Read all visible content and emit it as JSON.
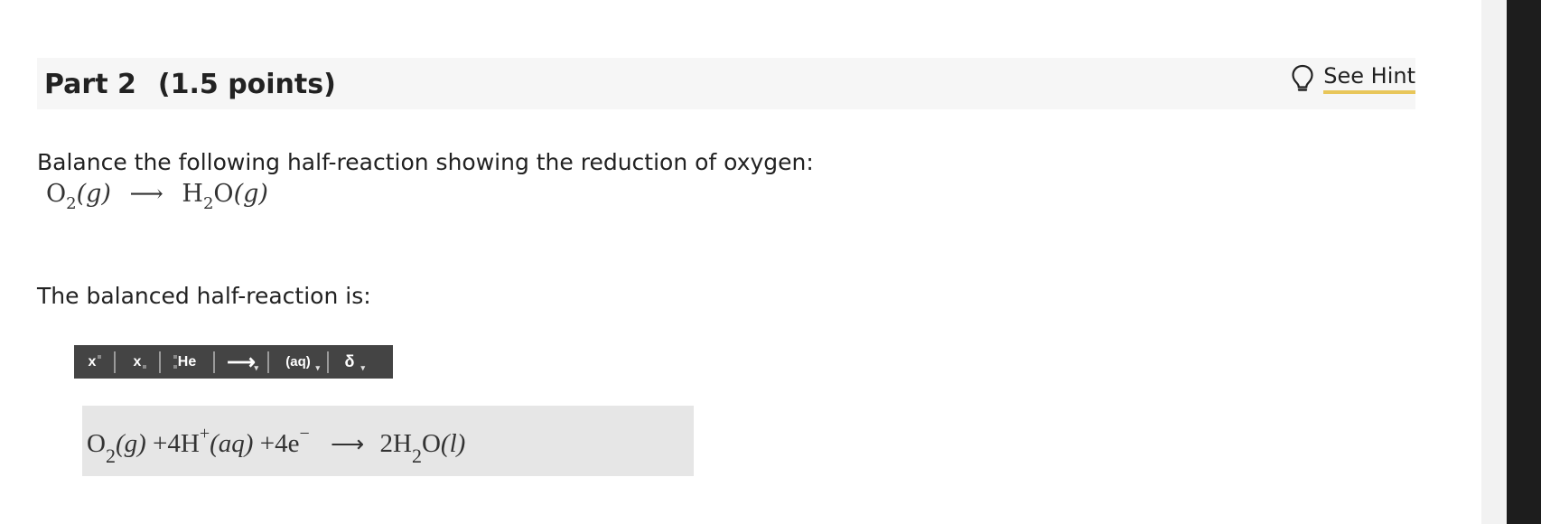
{
  "part": {
    "title": "Part 2",
    "points": "(1.5 points)",
    "hint_label": "See Hint"
  },
  "question": {
    "prompt": "Balance the following half-reaction showing the reduction of oxygen:",
    "equation": {
      "reactant": "O",
      "reactant_sub": "2",
      "reactant_state": "(g)",
      "arrow": "⟶",
      "product_h": "H",
      "product_sub": "2",
      "product_o": "O",
      "product_state": "(g)"
    },
    "balanced_label": "The balanced half-reaction is:"
  },
  "toolbar": {
    "superscript_label": "x",
    "subscript_label": "x",
    "element_label": "He",
    "arrow_label": "⟶",
    "state_label": "(aq)",
    "delta_label": "δ"
  },
  "answer": {
    "o": "O",
    "o_sub": "2",
    "o_state": "(g)",
    "plus1": "+",
    "h_coef": "4H",
    "h_sup": "+",
    "h_state": "(aq)",
    "plus2": "+",
    "e_coef": "4e",
    "e_sup": "−",
    "arrow": "⟶",
    "w_coef": "2H",
    "w_sub": "2",
    "w_o": "O",
    "w_state": "(l)"
  }
}
